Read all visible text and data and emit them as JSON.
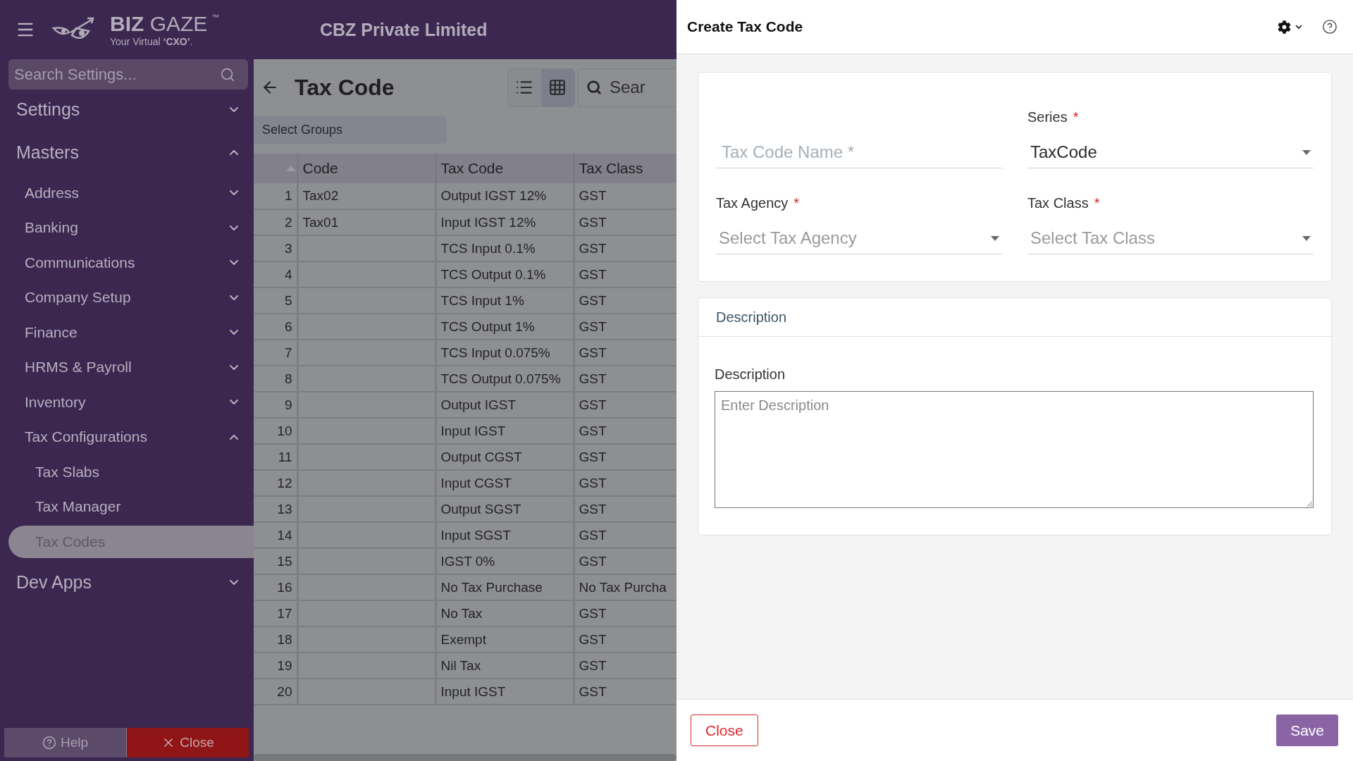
{
  "topbar": {
    "brand": {
      "name_bold": "BIZ",
      "name_light": "GAZE",
      "trademark": "™",
      "tagline": "Your Virtual **‘CXO’**."
    },
    "company": "CBZ Private Limited"
  },
  "sidebar": {
    "search_placeholder": "Search Settings...",
    "sections": [
      {
        "label": "Settings",
        "expanded": false
      },
      {
        "label": "Masters",
        "expanded": true,
        "children": [
          {
            "label": "Address",
            "expanded": false
          },
          {
            "label": "Banking",
            "expanded": false
          },
          {
            "label": "Communications",
            "expanded": false
          },
          {
            "label": "Company Setup",
            "expanded": false
          },
          {
            "label": "Finance",
            "expanded": false
          },
          {
            "label": "HRMS & Payroll",
            "expanded": false
          },
          {
            "label": "Inventory",
            "expanded": false
          },
          {
            "label": "Tax Configurations",
            "expanded": true,
            "children": [
              {
                "label": "Tax Slabs",
                "selected": false
              },
              {
                "label": "Tax Manager",
                "selected": false
              },
              {
                "label": "Tax Codes",
                "selected": true
              }
            ]
          }
        ]
      },
      {
        "label": "Dev Apps",
        "expanded": false
      }
    ],
    "buttons": [
      {
        "kind": "help",
        "label": "Help"
      },
      {
        "kind": "close",
        "label": "Close"
      }
    ]
  },
  "main": {
    "title": "Tax Code",
    "view_toggle": [
      {
        "kind": "list",
        "selected": false
      },
      {
        "kind": "grid",
        "selected": true
      }
    ],
    "search_placeholder": "Sear",
    "group_select": "Select Groups",
    "table": {
      "columns": [
        "Code",
        "Tax Code",
        "Tax Class"
      ],
      "rows": [
        {
          "index": "1",
          "code": "Tax02",
          "tax_code": "Output IGST 12%",
          "tax_class": "GST"
        },
        {
          "index": "2",
          "code": "Tax01",
          "tax_code": "Input IGST 12%",
          "tax_class": "GST"
        },
        {
          "index": "3",
          "tax_code": "TCS Input 0.1%",
          "tax_class": "GST"
        },
        {
          "index": "4",
          "tax_code": "TCS Output 0.1%",
          "tax_class": "GST"
        },
        {
          "index": "5",
          "tax_code": "TCS Input 1%",
          "tax_class": "GST"
        },
        {
          "index": "6",
          "tax_code": "TCS Output 1%",
          "tax_class": "GST"
        },
        {
          "index": "7",
          "tax_code": "TCS Input 0.075%",
          "tax_class": "GST"
        },
        {
          "index": "8",
          "tax_code": "TCS Output 0.075%",
          "tax_class": "GST"
        },
        {
          "index": "9",
          "tax_code": "Output IGST",
          "tax_class": "GST"
        },
        {
          "index": "10",
          "tax_code": "Input IGST",
          "tax_class": "GST"
        },
        {
          "index": "11",
          "tax_code": "Output CGST",
          "tax_class": "GST"
        },
        {
          "index": "12",
          "tax_code": "Input CGST",
          "tax_class": "GST"
        },
        {
          "index": "13",
          "tax_code": "Output SGST",
          "tax_class": "GST"
        },
        {
          "index": "14",
          "tax_code": "Input SGST",
          "tax_class": "GST"
        },
        {
          "index": "15",
          "tax_code": "IGST 0%",
          "tax_class": "GST"
        },
        {
          "index": "16",
          "tax_code": "No Tax Purchase",
          "tax_class": "No Tax Purcha"
        },
        {
          "index": "17",
          "tax_code": "No Tax",
          "tax_class": "GST"
        },
        {
          "index": "18",
          "tax_code": "Exempt",
          "tax_class": "GST"
        },
        {
          "index": "19",
          "tax_code": "Nil Tax",
          "tax_class": "GST"
        },
        {
          "index": "20",
          "tax_code": "Input IGST",
          "tax_class": "GST"
        }
      ]
    }
  },
  "drawer": {
    "title": "Create Tax Code",
    "fields": [
      {
        "kind": "text",
        "placeholder": "Tax Code Name *"
      },
      {
        "kind": "select",
        "label": "Tax Agency",
        "required_mark": "*",
        "placeholder": "Select Tax Agency"
      },
      {
        "kind": "select",
        "label": "Series",
        "required_mark": "*",
        "value": "TaxCode"
      },
      {
        "kind": "select",
        "label": "Tax Class",
        "required_mark": "*",
        "placeholder": "Select Tax Class"
      }
    ],
    "description_section": {
      "title": "Description",
      "label": "Description",
      "placeholder": "Enter Description"
    },
    "buttons": [
      {
        "kind": "secondary",
        "label": "Close"
      },
      {
        "kind": "primary",
        "label": "Save"
      }
    ]
  }
}
